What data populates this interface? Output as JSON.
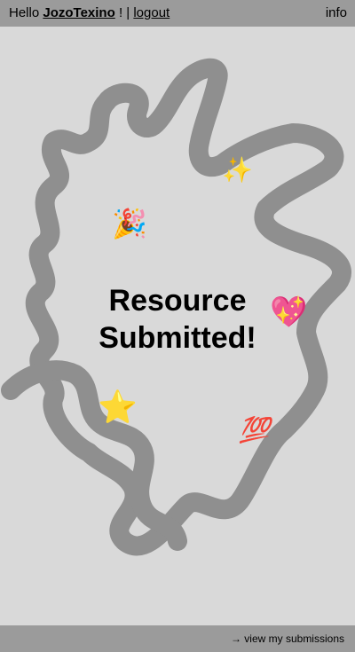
{
  "header": {
    "greeting_prefix": "Hello",
    "username": "JozoTexino",
    "separator": "! |",
    "logout_label": "logout",
    "info_label": "info"
  },
  "main": {
    "headline_line1": "Resource",
    "headline_line2": "Submitted!",
    "emojis": {
      "sparkles": "✨",
      "party": "🎉",
      "heart": "💖",
      "star": "⭐",
      "hundred": "💯"
    }
  },
  "footer": {
    "arrow": "→",
    "view_submissions_label": "view my submissions"
  },
  "colors": {
    "background": "#d9d9d9",
    "bars": "#9b9b9b",
    "scribble": "#8f8f8f"
  }
}
